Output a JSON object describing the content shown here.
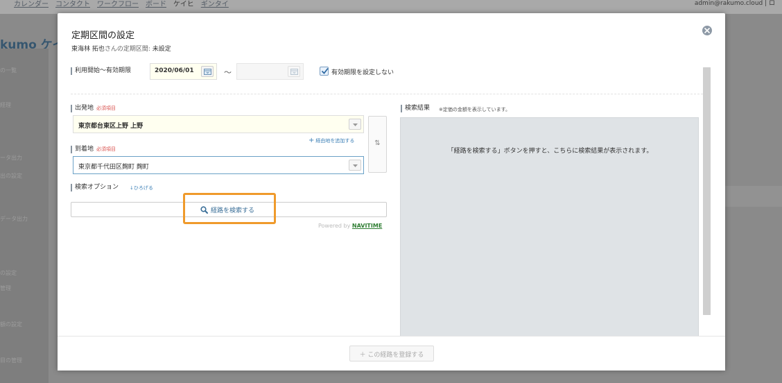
{
  "background": {
    "nav": [
      "カレンダー",
      "コンタクト",
      "ワークフロー",
      "ボード",
      "ケイヒ",
      "ギンタイ"
    ],
    "user": "admin@rakumo.cloud | ロ",
    "logo": "kumo ケイ",
    "sidebar": [
      "の一覧",
      "経理",
      "ータ出力",
      "出の設定",
      "データ出力",
      "の設定",
      "管理",
      "額の設定",
      "目の管理"
    ]
  },
  "modal": {
    "title": "定期区間の設定",
    "subtitle_user": "東海林 拓也",
    "subtitle_label": "さんの定期区間:",
    "subtitle_value": "未設定"
  },
  "period": {
    "label": "利用開始〜有効期限",
    "start_date": "2020/06/01",
    "end_date": "",
    "separator": "〜",
    "no_expiry_label": "有効期限を設定しない",
    "no_expiry_checked": true
  },
  "departure": {
    "label": "出発地",
    "required": "必須項目",
    "value": "東京都台東区上野 上野"
  },
  "add_via": "経由地を追加する",
  "arrival": {
    "label": "到着地",
    "required": "必須項目",
    "value": "東京都千代田区麹町 麹町"
  },
  "swap": "⇅",
  "options": {
    "label": "検索オプション",
    "expand": "↓ひろげる"
  },
  "search_button": "経路を検索する",
  "powered": {
    "prefix": "Powered by",
    "brand": "NAVITIME"
  },
  "results": {
    "label": "検索結果",
    "note": "※定価の金額を表示しています。",
    "empty_message": "「経路を検索する」ボタンを押すと、こちらに検索結果が表示されます。"
  },
  "footer": {
    "register_button": "＋ この経路を登録する"
  },
  "colors": {
    "highlight": "#ef9a2b",
    "link": "#3b7fb6",
    "required": "#d9534f",
    "navitime": "#2e7d32"
  }
}
